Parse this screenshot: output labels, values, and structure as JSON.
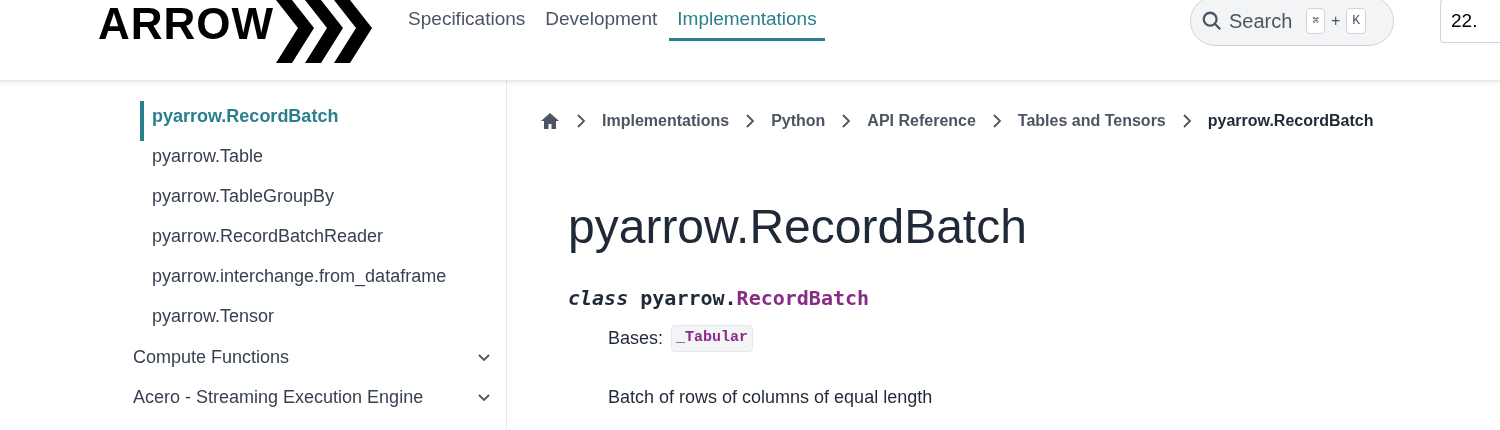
{
  "header": {
    "logo": "ARROW",
    "nav": [
      {
        "label": "Specifications",
        "selected": false
      },
      {
        "label": "Development",
        "selected": false
      },
      {
        "label": "Implementations",
        "selected": true
      }
    ],
    "search": {
      "placeholder": "Search",
      "keys": [
        "⌘",
        "K"
      ],
      "plus": "+"
    },
    "version": "22."
  },
  "sidebar": {
    "items": [
      {
        "label": "pyarrow.RecordBatch",
        "kind": "page",
        "selected": true
      },
      {
        "label": "pyarrow.Table",
        "kind": "page",
        "selected": false
      },
      {
        "label": "pyarrow.TableGroupBy",
        "kind": "page",
        "selected": false
      },
      {
        "label": "pyarrow.RecordBatchReader",
        "kind": "page",
        "selected": false
      },
      {
        "label": "pyarrow.interchange.from_dataframe",
        "kind": "page",
        "selected": false
      },
      {
        "label": "pyarrow.Tensor",
        "kind": "page",
        "selected": false
      },
      {
        "label": "Compute Functions",
        "kind": "section",
        "selected": false,
        "expanded": false
      },
      {
        "label": "Acero - Streaming Execution Engine",
        "kind": "section",
        "selected": false,
        "expanded": false
      }
    ]
  },
  "breadcrumbs": [
    "Implementations",
    "Python",
    "API Reference",
    "Tables and Tensors",
    "pyarrow.RecordBatch"
  ],
  "content": {
    "title": "pyarrow.RecordBatch",
    "signature": {
      "keyword": "class",
      "module": "pyarrow.",
      "name": "RecordBatch"
    },
    "bases_label": "Bases:",
    "base": "_Tabular",
    "description": "Batch of rows of columns of equal length"
  }
}
